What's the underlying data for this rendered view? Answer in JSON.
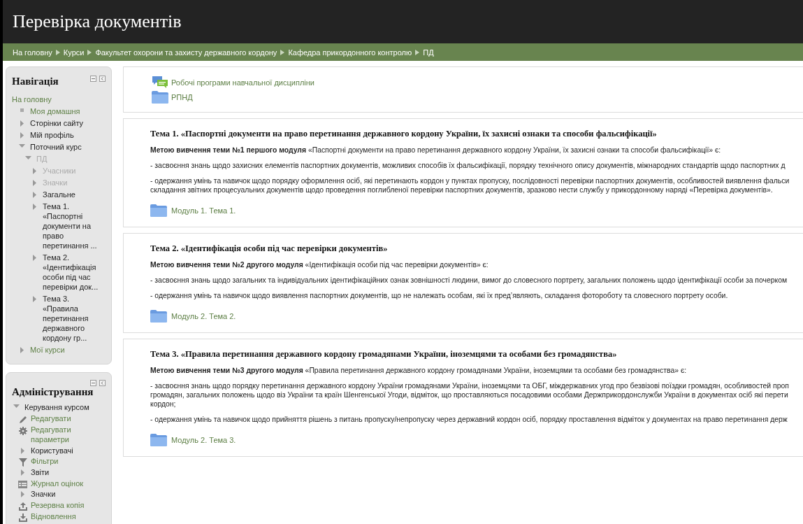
{
  "header": {
    "title": "Перевірка документів"
  },
  "breadcrumb": [
    "На головну",
    "Курси",
    "Факультет охорони та захисту державного кордону",
    "Кафедра прикордонного контролю",
    "ПД"
  ],
  "navigation": {
    "title": "Навігація",
    "items": [
      {
        "label": "На головну",
        "link": true,
        "dimmed": false,
        "children": [
          {
            "label": "Моя домашня",
            "kind": "bullet",
            "link": true,
            "dimmed": false
          },
          {
            "label": "Сторінки сайту",
            "kind": "branch",
            "expanded": false,
            "link": false,
            "dimmed": false
          },
          {
            "label": "Мій профіль",
            "kind": "branch",
            "expanded": false,
            "link": false,
            "dimmed": false
          },
          {
            "label": "Поточний курс",
            "kind": "branch",
            "expanded": true,
            "link": false,
            "dimmed": false,
            "children": [
              {
                "label": "ПД",
                "kind": "branch",
                "expanded": true,
                "link": false,
                "dimmed": true,
                "children": [
                  {
                    "label": "Учасники",
                    "kind": "branch",
                    "expanded": false,
                    "link": false,
                    "dimmed": true
                  },
                  {
                    "label": "Значки",
                    "kind": "branch",
                    "expanded": false,
                    "link": false,
                    "dimmed": true
                  },
                  {
                    "label": "Загальне",
                    "kind": "branch",
                    "expanded": false,
                    "link": false,
                    "dimmed": false
                  },
                  {
                    "label": "Тема 1. «Паспортні документи на право перетинання ...",
                    "kind": "branch",
                    "expanded": false,
                    "link": false,
                    "dimmed": false
                  },
                  {
                    "label": "Тема 2. «Ідентифікація особи під час перевірки док...",
                    "kind": "branch",
                    "expanded": false,
                    "link": false,
                    "dimmed": false
                  },
                  {
                    "label": "Тема 3. «Правила перетинання державного кордону гр...",
                    "kind": "branch",
                    "expanded": false,
                    "link": false,
                    "dimmed": false
                  }
                ]
              }
            ]
          },
          {
            "label": "Мої курси",
            "kind": "branch",
            "expanded": false,
            "link": true,
            "dimmed": false
          }
        ]
      }
    ]
  },
  "administration": {
    "title": "Адміністрування",
    "items": [
      {
        "label": "Керування курсом",
        "kind": "branch",
        "expanded": true,
        "link": false,
        "dimmed": false,
        "children": [
          {
            "label": "Редагувати",
            "kind": "pencil",
            "link": true,
            "dimmed": false
          },
          {
            "label": "Редагувати параметри",
            "kind": "gear",
            "link": true,
            "dimmed": false
          },
          {
            "label": "Користувачі",
            "kind": "branch",
            "expanded": false,
            "link": false,
            "dimmed": false
          },
          {
            "label": "Фільтри",
            "kind": "filter",
            "link": true,
            "dimmed": false
          },
          {
            "label": "Звіти",
            "kind": "branch",
            "expanded": false,
            "link": false,
            "dimmed": false
          },
          {
            "label": "Журнал оцінок",
            "kind": "table",
            "link": true,
            "dimmed": false
          },
          {
            "label": "Значки",
            "kind": "branch",
            "expanded": false,
            "link": false,
            "dimmed": false
          },
          {
            "label": "Резервна копія",
            "kind": "upload",
            "link": true,
            "dimmed": false
          },
          {
            "label": "Відновлення",
            "kind": "download",
            "link": true,
            "dimmed": false
          }
        ]
      }
    ]
  },
  "activities": [
    {
      "kind": "forum",
      "label": "Робочі програми навчальної дисципліни"
    },
    {
      "kind": "folder",
      "label": "РПНД"
    }
  ],
  "sections": [
    {
      "title": "Тема 1. «Паспортні документи на право перетинання державного кордону України, їх захисні ознаки та способи фальсифікації»",
      "intro": "**Метою вивчення теми №1 першого модуля** «Паспортні документи на право перетинання державного кордону України, їх захисні ознаки та способи фальсифікації» є:",
      "paragraphs": [
        [
          "- засвоєння знань щодо захисних елементів паспортних документів, можливих способів їх фальсифікації, порядку технічного опису документів, міжнародних стандартів щодо паспортних д"
        ],
        [
          "- одержання умінь та навичок щодо порядку оформлення осіб, які перетинають кордон у пунктах пропуску, послідовності перевірки паспортних документів, особливостей виявлення фальси",
          "складання звітних процесуальних документів щодо проведення поглибленої перевірки паспортних документів, зразково нести службу у прикордонному наряді «Перевірка документів»."
        ]
      ],
      "resource": {
        "kind": "folder",
        "label": "Модуль 1. Тема 1."
      }
    },
    {
      "title": "Тема 2. «Ідентифікація особи під час перевірки документів»",
      "intro": "**Метою вивчення теми №2 другого модуля** «Ідентифікація особи під час перевірки документів» є:",
      "paragraphs": [
        [
          "- засвоєння знань щодо загальних та індивідуальних ідентифікаційних ознак зовнішності людини, вимог до словесного портрету, загальних положень щодо ідентифікації особи за почерком"
        ],
        [
          "- одержання умінь та навичок щодо виявлення паспортних документів, що не належать особам, які їх пред’являють, складання фотороботу та словесного портрету особи."
        ]
      ],
      "resource": {
        "kind": "folder",
        "label": "Модуль 2. Тема 2."
      }
    },
    {
      "title": "Тема 3. «Правила перетинання державного кордону громадянами України, іноземцями та особами без громадянства»",
      "intro": "**Метою вивчення теми №3 другого модуля** «Правила перетинання державного кордону громадянами України, іноземцями та особами без громадянства» є:",
      "paragraphs": [
        [
          "- засвоєння знань щодо порядку перетинання державного кордону України громадянами України, іноземцями та ОБГ, міждержавних угод про безвізові поїздки громадян, особливостей проп",
          "громадян, загальних положень щодо віз України та країн Шенгенської Угоди, відміток, що проставляються посадовими особами Держприкордонслужби України в документах осіб які перети",
          "кордон;"
        ],
        [
          "- одержання умінь та навичок щодо прийняття рішень з питань пропуску/непропуску через державний кордон осіб, порядку проставлення відміток у документах на право перетинання держ"
        ]
      ],
      "resource": {
        "kind": "folder",
        "label": "Модуль 2. Тема 3."
      }
    }
  ]
}
